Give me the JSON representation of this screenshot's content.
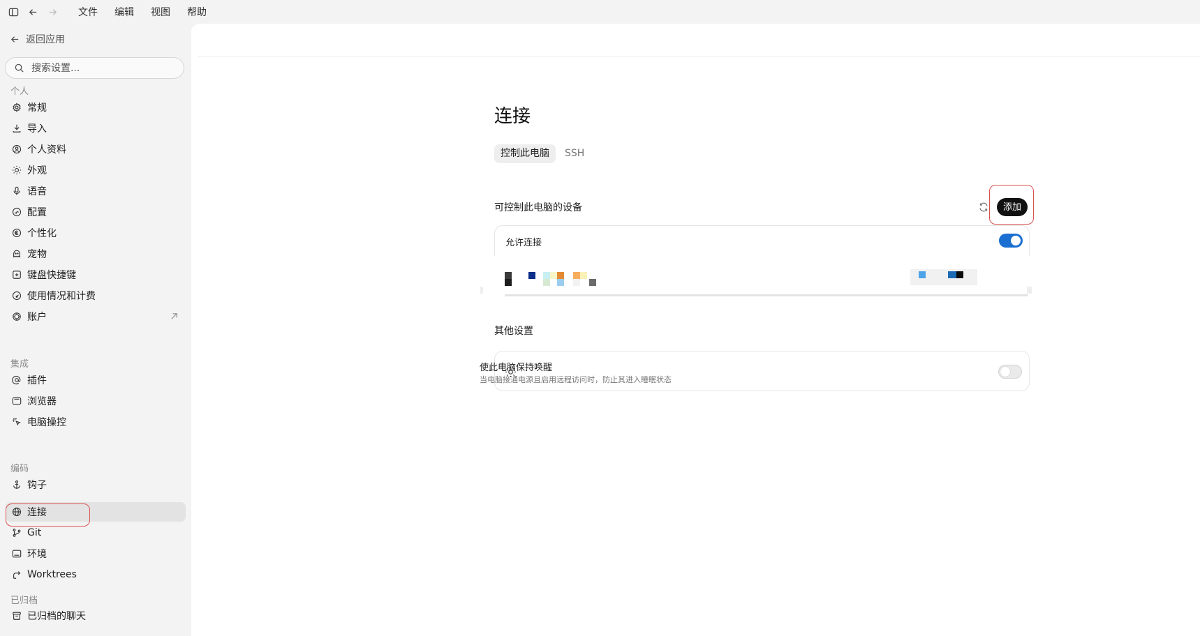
{
  "menubar": {
    "items": [
      "文件",
      "编辑",
      "视图",
      "帮助"
    ]
  },
  "sidebar": {
    "back_label": "返回应用",
    "search_placeholder": "搜索设置...",
    "sections": [
      {
        "title": "个人",
        "items": [
          {
            "label": "常规",
            "icon": "gear-icon"
          },
          {
            "label": "导入",
            "icon": "download-icon"
          },
          {
            "label": "个人资料",
            "icon": "user-circle-icon"
          },
          {
            "label": "外观",
            "icon": "sun-icon"
          },
          {
            "label": "语音",
            "icon": "microphone-icon"
          },
          {
            "label": "配置",
            "icon": "config-icon"
          },
          {
            "label": "个性化",
            "icon": "personalize-icon"
          },
          {
            "label": "宠物",
            "icon": "pet-icon"
          },
          {
            "label": "键盘快捷键",
            "icon": "keyboard-icon"
          },
          {
            "label": "使用情况和计费",
            "icon": "gauge-icon"
          },
          {
            "label": "账户",
            "icon": "account-icon"
          }
        ]
      },
      {
        "title": "集成",
        "items": [
          {
            "label": "插件",
            "icon": "at-icon"
          },
          {
            "label": "浏览器",
            "icon": "browser-icon"
          },
          {
            "label": "电脑操控",
            "icon": "cursor-icon"
          }
        ]
      },
      {
        "title": "编码",
        "items": [
          {
            "label": "钩子",
            "icon": "anchor-icon"
          },
          {
            "label": "连接",
            "icon": "globe-icon",
            "active": true
          },
          {
            "label": "Git",
            "icon": "git-branch-icon"
          },
          {
            "label": "环境",
            "icon": "monitor-icon"
          },
          {
            "label": "Worktrees",
            "icon": "worktree-icon"
          }
        ]
      },
      {
        "title": "已归档",
        "items": [
          {
            "label": "已归档的聊天",
            "icon": "archive-icon"
          }
        ]
      }
    ]
  },
  "main": {
    "title": "连接",
    "tabs": [
      {
        "label": "控制此电脑",
        "active": true
      },
      {
        "label": "SSH",
        "active": false
      }
    ],
    "devices": {
      "heading": "可控制此电脑的设备",
      "add_label": "添加",
      "allow_label": "允许连接",
      "allow_enabled": true
    },
    "other": {
      "heading": "其他设置",
      "keep_awake_label": "使此电脑保持唤醒",
      "keep_awake_desc": "当电脑接通电源且启用远程访问时，防止其进入睡眠状态",
      "keep_awake_enabled": false
    }
  },
  "colors": {
    "accent": "#1a6fd1",
    "highlight_red": "#d9534f",
    "button_dark": "#111111"
  }
}
